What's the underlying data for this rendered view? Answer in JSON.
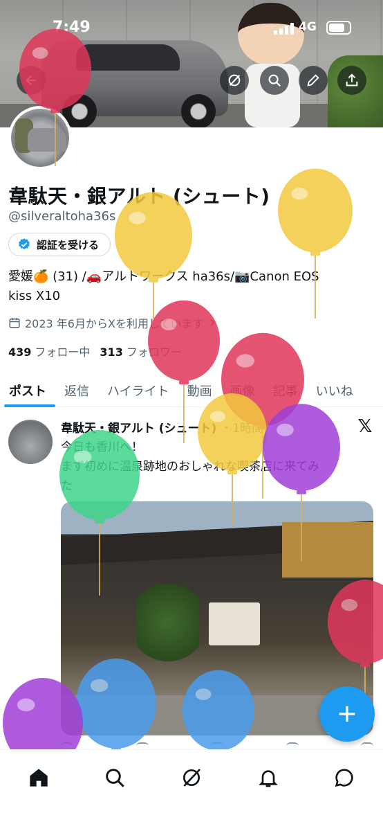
{
  "status_bar": {
    "time": "7:49",
    "network": "4G"
  },
  "header": {
    "icons": [
      "back-arrow-icon",
      "grok-icon",
      "search-icon",
      "edit-icon",
      "share-icon"
    ]
  },
  "profile": {
    "name": "韋駄天・銀アルト (シュート)",
    "handle": "@silveraltoha36s",
    "verify_button_label": "認証を受ける",
    "bio_line1": "愛媛🍊 (31) /🚗アルトワークス ha36s/📷Canon EOS",
    "bio_line2": "kiss X10",
    "joined": "2023 年6月からXを利用しています",
    "following_count": "439",
    "following_label": "フォロー中",
    "followers_count": "313",
    "followers_label": "フォロワー"
  },
  "tabs": [
    {
      "label": "ポスト",
      "active": true
    },
    {
      "label": "返信"
    },
    {
      "label": "ハイライト"
    },
    {
      "label": "動画"
    },
    {
      "label": "画像"
    },
    {
      "label": "記事"
    },
    {
      "label": "いいね"
    }
  ],
  "post": {
    "author": "韋駄天・銀アルト (シュート)",
    "time": "・1時間",
    "text_line1": "今日も香川へ！",
    "text_line2": "まず初めに温泉跡地のおしゃれな喫茶店に来てみ",
    "text_line3": "た"
  },
  "colors": {
    "accent": "#1d9bf0",
    "text": "#0f1419",
    "muted": "#536471"
  },
  "bottom_nav": [
    "home-icon",
    "search-icon",
    "grok-icon",
    "notifications-icon",
    "messages-icon"
  ],
  "balloons": [
    {
      "color": "#e0375a"
    },
    {
      "color": "#f3c93e"
    },
    {
      "color": "#f3c93e"
    },
    {
      "color": "#e0375a"
    },
    {
      "color": "#e0375a"
    },
    {
      "color": "#f3c93e"
    },
    {
      "color": "#a040d8"
    },
    {
      "color": "#3fd58a"
    },
    {
      "color": "#e0375a"
    },
    {
      "color": "#4a9cec"
    },
    {
      "color": "#4a9cec"
    },
    {
      "color": "#a040d8"
    }
  ]
}
